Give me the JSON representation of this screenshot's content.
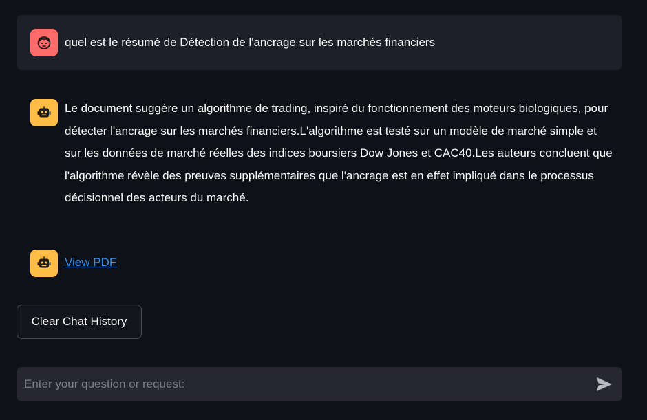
{
  "messages": {
    "user": {
      "text": "quel est le résumé de Détection de l'ancrage sur les marchés financiers",
      "avatar_icon": "user-face-icon",
      "avatar_color": "#ff6b6b"
    },
    "assistant": {
      "text": "Le document suggère un algorithme de trading, inspiré du fonctionnement des moteurs biologiques, pour détecter l'ancrage sur les marchés financiers.L'algorithme est testé sur un modèle de marché simple et sur les données de marché réelles des indices boursiers Dow Jones et CAC40.Les auteurs concluent que l'algorithme révèle des preuves supplémentaires que l'ancrage est en effet impliqué dans le processus décisionnel des acteurs du marché.",
      "avatar_icon": "robot-icon",
      "avatar_color": "#ffbd45"
    },
    "assistant_link": {
      "link_text": "View PDF",
      "avatar_icon": "robot-icon",
      "link_color": "#3a8ee6"
    }
  },
  "buttons": {
    "clear_history": "Clear Chat History"
  },
  "chat_input": {
    "placeholder": "Enter your question or request:",
    "value": "",
    "send_icon": "send-icon"
  },
  "colors": {
    "background": "#0e1117",
    "user_bubble": "#1e2029",
    "input_bg": "#262730"
  }
}
